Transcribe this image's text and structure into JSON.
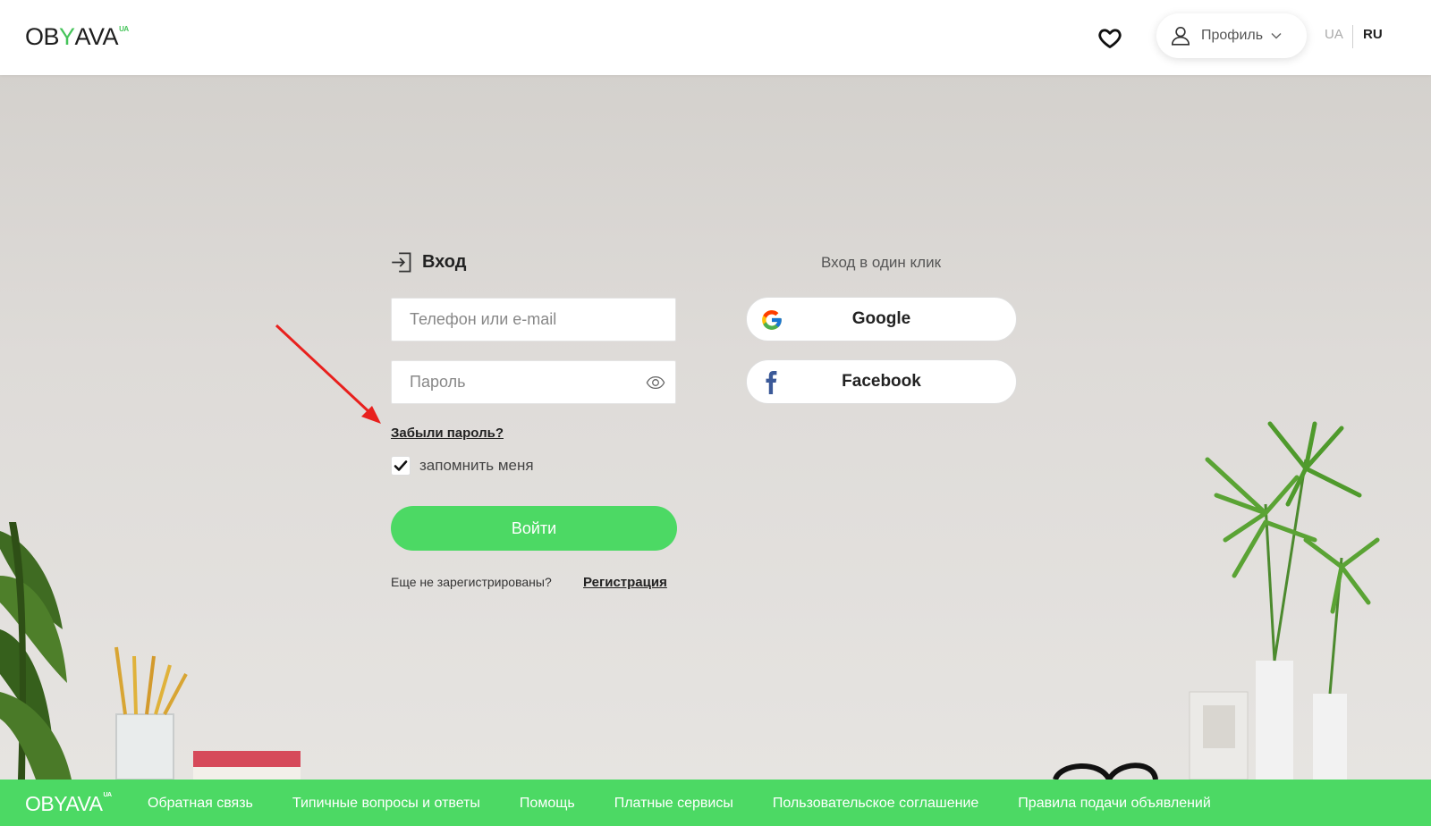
{
  "header": {
    "logo": {
      "text_a": "OB",
      "text_y": "Y",
      "text_b": "AVA",
      "sup": "UA"
    },
    "profile_label": "Профиль",
    "lang_ua": "UA",
    "lang_ru": "RU"
  },
  "login": {
    "title": "Вход",
    "login_placeholder": "Телефон или e-mail",
    "password_placeholder": "Пароль",
    "forgot": "Забыли пароль?",
    "remember": "запомнить меня",
    "remember_checked": true,
    "submit": "Войти",
    "not_registered": "Еще не зарегистрированы?",
    "register": "Регистрация"
  },
  "social": {
    "title": "Вход в один клик",
    "google": "Google",
    "facebook": "Facebook"
  },
  "footer": {
    "logo": {
      "text": "OBYAVA",
      "sup": "UA"
    },
    "links": [
      "Обратная связь",
      "Типичные вопросы и ответы",
      "Помощь",
      "Платные сервисы",
      "Пользовательское соглашение",
      "Правила подачи объявлений"
    ]
  },
  "colors": {
    "accent": "#4cd964",
    "annotation_arrow": "#e8201d"
  }
}
